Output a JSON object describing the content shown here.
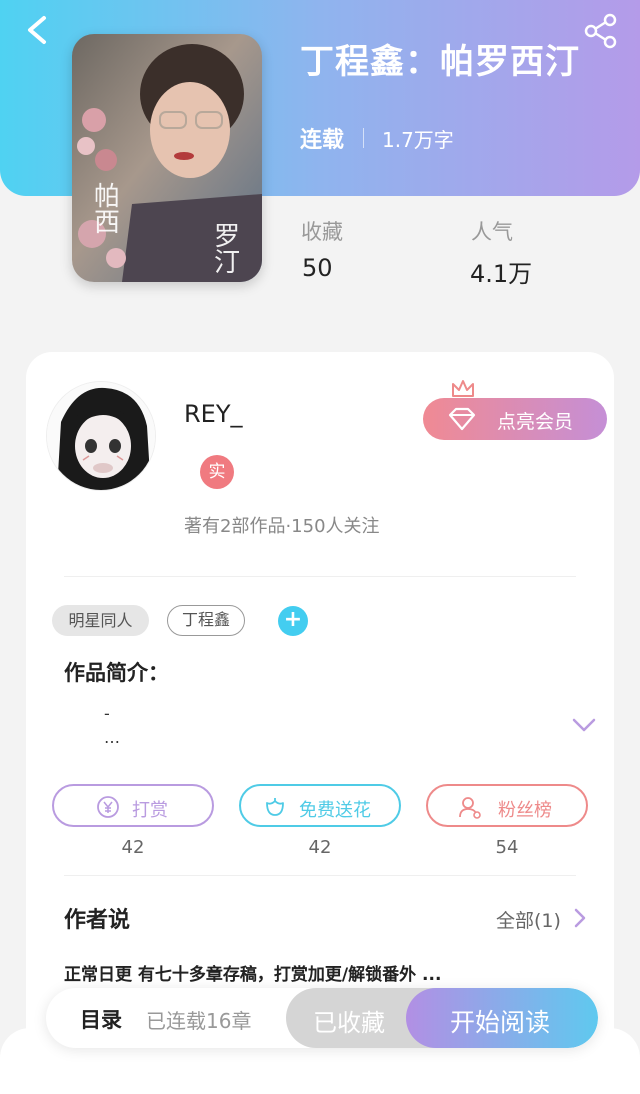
{
  "book": {
    "title": "丁程鑫：帕罗西汀",
    "status": "连载",
    "word_count": "1.7万字",
    "cover_text_1": "帕\n西",
    "cover_text_2": "罗\n汀"
  },
  "stats": {
    "favorites_label": "收藏",
    "favorites_value": "50",
    "popularity_label": "人气",
    "popularity_value": "4.1万"
  },
  "author": {
    "name": "REY_",
    "verified_badge": "实",
    "stats": "著有2部作品·150人关注",
    "member_button": "点亮会员"
  },
  "tags": {
    "items": [
      "明星同人",
      "丁程鑫"
    ],
    "add_symbol": "+"
  },
  "intro": {
    "title": "作品简介：",
    "lines": [
      "-",
      "…"
    ]
  },
  "actions": [
    {
      "label": "打赏",
      "count": "42",
      "color": "#b99be0"
    },
    {
      "label": "免费送花",
      "count": "42",
      "color": "#4fcbe6"
    },
    {
      "label": "粉丝榜",
      "count": "54",
      "color": "#ee8a8a"
    }
  ],
  "author_says": {
    "title": "作者说",
    "all_link": "全部(1)",
    "text": "正常日更 有七十多章存稿，打赏加更/解锁番外 ..."
  },
  "bottom_bar": {
    "toc_label": "目录",
    "toc_count": "已连载16章",
    "favorited_label": "已收藏",
    "read_label": "开始阅读"
  },
  "colors": {
    "accent_cyan": "#4fd2f2",
    "accent_purple": "#b49be9",
    "member_pink": "#f08a93"
  }
}
